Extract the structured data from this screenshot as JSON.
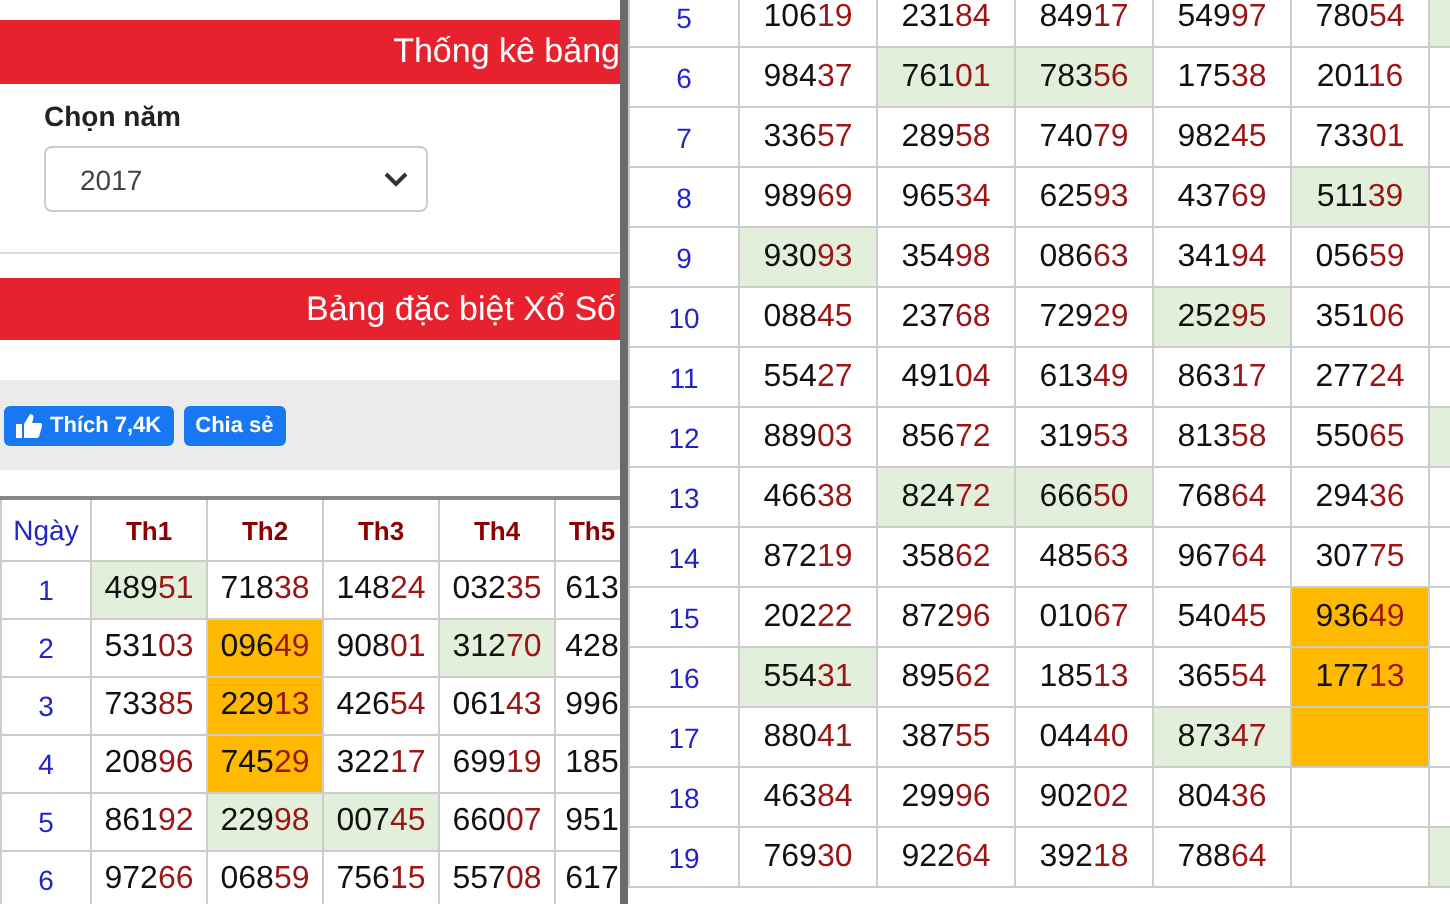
{
  "left_panel": {
    "header_title": "Thống kê bảng",
    "year_label": "Chọn năm",
    "year_select": {
      "value": "2017"
    },
    "section_title": "Bảng đặc biệt Xổ Số",
    "like_button": "Thích 7,4K",
    "share_button": "Chia sẻ",
    "table": {
      "columns": [
        "Ngày",
        "Th1",
        "Th2",
        "Th3",
        "Th4",
        "Th5"
      ],
      "rows": [
        {
          "cells": [
            {
              "kind": "day",
              "value": "1"
            },
            {
              "kind": "number",
              "value": "48951",
              "color": "#e2efda"
            },
            {
              "kind": "number",
              "value": "71838"
            },
            {
              "kind": "number",
              "value": "14824"
            },
            {
              "kind": "number",
              "value": "03235"
            },
            {
              "kind": "number",
              "value": "613"
            }
          ]
        },
        {
          "cells": [
            {
              "kind": "day",
              "value": "2"
            },
            {
              "kind": "number",
              "value": "53103"
            },
            {
              "kind": "number",
              "value": "09649",
              "color": "#ffb900"
            },
            {
              "kind": "number",
              "value": "90801"
            },
            {
              "kind": "number",
              "value": "31270",
              "color": "#e2efda"
            },
            {
              "kind": "number",
              "value": "428"
            }
          ]
        },
        {
          "cells": [
            {
              "kind": "day",
              "value": "3"
            },
            {
              "kind": "number",
              "value": "73385"
            },
            {
              "kind": "number",
              "value": "22913",
              "color": "#ffb900"
            },
            {
              "kind": "number",
              "value": "42654"
            },
            {
              "kind": "number",
              "value": "06143"
            },
            {
              "kind": "number",
              "value": "996"
            }
          ]
        },
        {
          "cells": [
            {
              "kind": "day",
              "value": "4"
            },
            {
              "kind": "number",
              "value": "20896"
            },
            {
              "kind": "number",
              "value": "74529",
              "color": "#ffb900"
            },
            {
              "kind": "number",
              "value": "32217"
            },
            {
              "kind": "number",
              "value": "69919"
            },
            {
              "kind": "number",
              "value": "185"
            }
          ]
        },
        {
          "cells": [
            {
              "kind": "day",
              "value": "5"
            },
            {
              "kind": "number",
              "value": "86192"
            },
            {
              "kind": "number",
              "value": "22998",
              "color": "#e2efda"
            },
            {
              "kind": "number",
              "value": "00745",
              "color": "#e2efda"
            },
            {
              "kind": "number",
              "value": "66007"
            },
            {
              "kind": "number",
              "value": "951"
            }
          ]
        },
        {
          "cells": [
            {
              "kind": "day",
              "value": "6"
            },
            {
              "kind": "number",
              "value": "97266"
            },
            {
              "kind": "number",
              "value": "06859"
            },
            {
              "kind": "number",
              "value": "75615"
            },
            {
              "kind": "number",
              "value": "55708"
            },
            {
              "kind": "number",
              "value": "617"
            }
          ]
        }
      ]
    }
  },
  "right_panel": {
    "table": {
      "rows": [
        {
          "cells": [
            {
              "kind": "day",
              "value": "5"
            },
            {
              "kind": "number",
              "value": "10619"
            },
            {
              "kind": "number",
              "value": "23184"
            },
            {
              "kind": "number",
              "value": "84917"
            },
            {
              "kind": "number",
              "value": "54997"
            },
            {
              "kind": "number",
              "value": "78054"
            },
            {
              "kind": "empty",
              "color": "#e2efda"
            }
          ]
        },
        {
          "cells": [
            {
              "kind": "day",
              "value": "6"
            },
            {
              "kind": "number",
              "value": "98437"
            },
            {
              "kind": "number",
              "value": "76101",
              "color": "#e2efda"
            },
            {
              "kind": "number",
              "value": "78356",
              "color": "#e2efda"
            },
            {
              "kind": "number",
              "value": "17538"
            },
            {
              "kind": "number",
              "value": "20116"
            },
            {
              "kind": "empty"
            }
          ]
        },
        {
          "cells": [
            {
              "kind": "day",
              "value": "7"
            },
            {
              "kind": "number",
              "value": "33657"
            },
            {
              "kind": "number",
              "value": "28958"
            },
            {
              "kind": "number",
              "value": "74079"
            },
            {
              "kind": "number",
              "value": "98245"
            },
            {
              "kind": "number",
              "value": "73301"
            },
            {
              "kind": "empty"
            }
          ]
        },
        {
          "cells": [
            {
              "kind": "day",
              "value": "8"
            },
            {
              "kind": "number",
              "value": "98969"
            },
            {
              "kind": "number",
              "value": "96534"
            },
            {
              "kind": "number",
              "value": "62593"
            },
            {
              "kind": "number",
              "value": "43769"
            },
            {
              "kind": "number",
              "value": "51139",
              "color": "#e2efda"
            },
            {
              "kind": "empty"
            }
          ]
        },
        {
          "cells": [
            {
              "kind": "day",
              "value": "9"
            },
            {
              "kind": "number",
              "value": "93093",
              "color": "#e2efda"
            },
            {
              "kind": "number",
              "value": "35498"
            },
            {
              "kind": "number",
              "value": "08663"
            },
            {
              "kind": "number",
              "value": "34194"
            },
            {
              "kind": "number",
              "value": "05659"
            },
            {
              "kind": "empty"
            }
          ]
        },
        {
          "cells": [
            {
              "kind": "day",
              "value": "10"
            },
            {
              "kind": "number",
              "value": "08845"
            },
            {
              "kind": "number",
              "value": "23768"
            },
            {
              "kind": "number",
              "value": "72929"
            },
            {
              "kind": "number",
              "value": "25295",
              "color": "#e2efda"
            },
            {
              "kind": "number",
              "value": "35106"
            },
            {
              "kind": "empty"
            }
          ]
        },
        {
          "cells": [
            {
              "kind": "day",
              "value": "11"
            },
            {
              "kind": "number",
              "value": "55427"
            },
            {
              "kind": "number",
              "value": "49104"
            },
            {
              "kind": "number",
              "value": "61349"
            },
            {
              "kind": "number",
              "value": "86317"
            },
            {
              "kind": "number",
              "value": "27724"
            },
            {
              "kind": "empty"
            }
          ]
        },
        {
          "cells": [
            {
              "kind": "day",
              "value": "12"
            },
            {
              "kind": "number",
              "value": "88903"
            },
            {
              "kind": "number",
              "value": "85672"
            },
            {
              "kind": "number",
              "value": "31953"
            },
            {
              "kind": "number",
              "value": "81358"
            },
            {
              "kind": "number",
              "value": "55065"
            },
            {
              "kind": "empty",
              "color": "#e2efda"
            }
          ]
        },
        {
          "cells": [
            {
              "kind": "day",
              "value": "13"
            },
            {
              "kind": "number",
              "value": "46638"
            },
            {
              "kind": "number",
              "value": "82472",
              "color": "#e2efda"
            },
            {
              "kind": "number",
              "value": "66650",
              "color": "#e2efda"
            },
            {
              "kind": "number",
              "value": "76864"
            },
            {
              "kind": "number",
              "value": "29436"
            },
            {
              "kind": "empty"
            }
          ]
        },
        {
          "cells": [
            {
              "kind": "day",
              "value": "14"
            },
            {
              "kind": "number",
              "value": "87219"
            },
            {
              "kind": "number",
              "value": "35862"
            },
            {
              "kind": "number",
              "value": "48563"
            },
            {
              "kind": "number",
              "value": "96764"
            },
            {
              "kind": "number",
              "value": "30775"
            },
            {
              "kind": "empty"
            }
          ]
        },
        {
          "cells": [
            {
              "kind": "day",
              "value": "15"
            },
            {
              "kind": "number",
              "value": "20222"
            },
            {
              "kind": "number",
              "value": "87296"
            },
            {
              "kind": "number",
              "value": "01067"
            },
            {
              "kind": "number",
              "value": "54045"
            },
            {
              "kind": "number",
              "value": "93649",
              "color": "#ffb900"
            },
            {
              "kind": "empty"
            }
          ]
        },
        {
          "cells": [
            {
              "kind": "day",
              "value": "16"
            },
            {
              "kind": "number",
              "value": "55431",
              "color": "#e2efda"
            },
            {
              "kind": "number",
              "value": "89562"
            },
            {
              "kind": "number",
              "value": "18513"
            },
            {
              "kind": "number",
              "value": "36554"
            },
            {
              "kind": "number",
              "value": "17713",
              "color": "#ffb900"
            },
            {
              "kind": "empty"
            }
          ]
        },
        {
          "cells": [
            {
              "kind": "day",
              "value": "17"
            },
            {
              "kind": "number",
              "value": "88041"
            },
            {
              "kind": "number",
              "value": "38755"
            },
            {
              "kind": "number",
              "value": "04440"
            },
            {
              "kind": "number",
              "value": "87347",
              "color": "#e2efda"
            },
            {
              "kind": "empty",
              "color": "#ffb900"
            },
            {
              "kind": "empty"
            }
          ]
        },
        {
          "cells": [
            {
              "kind": "day",
              "value": "18"
            },
            {
              "kind": "number",
              "value": "46384"
            },
            {
              "kind": "number",
              "value": "29996"
            },
            {
              "kind": "number",
              "value": "90202"
            },
            {
              "kind": "number",
              "value": "80436"
            },
            {
              "kind": "empty"
            },
            {
              "kind": "empty"
            }
          ]
        },
        {
          "cells": [
            {
              "kind": "day",
              "value": "19"
            },
            {
              "kind": "number",
              "value": "76930"
            },
            {
              "kind": "number",
              "value": "92264"
            },
            {
              "kind": "number",
              "value": "39218"
            },
            {
              "kind": "number",
              "value": "78864"
            },
            {
              "kind": "empty"
            },
            {
              "kind": "empty",
              "color": "#e2efda"
            }
          ]
        }
      ]
    }
  }
}
